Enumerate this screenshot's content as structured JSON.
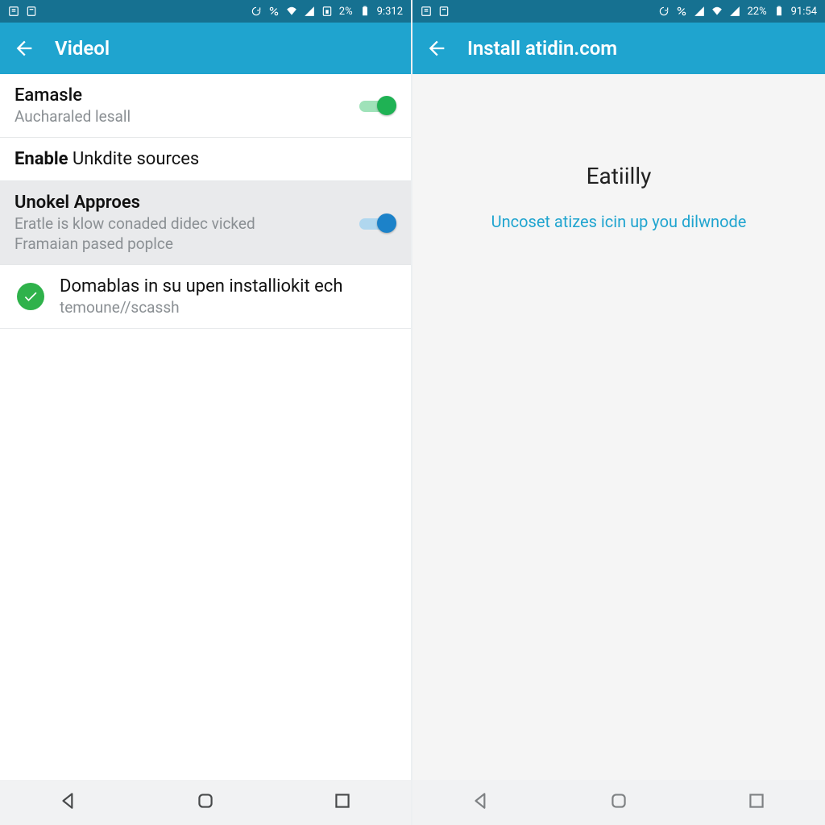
{
  "left": {
    "status": {
      "battery": "2%",
      "time": "9:312"
    },
    "appbar_title": "Videol",
    "rows": {
      "r1": {
        "title": "Eamasle",
        "sub": "Aucharaled lesall"
      },
      "r2": {
        "title_a": "Enable",
        "title_b": " Unkdite sources"
      },
      "r3": {
        "title": "Unokel Approes",
        "sub1": "Eratle is klow conaded didec vicked",
        "sub2": "Framaian pased poplce"
      },
      "r4": {
        "title": "Domablas in su upen installiokit ech",
        "sub": "temoune//scassh"
      }
    }
  },
  "right": {
    "status": {
      "battery": "22%",
      "time": "91:54"
    },
    "appbar_title": "Install atidin.com",
    "heading": "Eatiilly",
    "sub": "Uncoset atizes icin up you dilwnode"
  }
}
